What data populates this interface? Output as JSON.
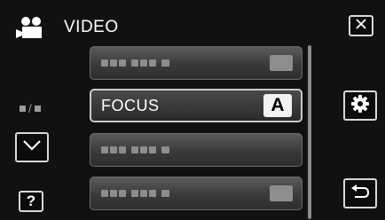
{
  "header": {
    "icon": "movie-camera-icon",
    "title": "VIDEO"
  },
  "menu": {
    "items": [
      {
        "label": "",
        "value": "",
        "state": "dimmed"
      },
      {
        "label": "FOCUS",
        "value": "A",
        "state": "selected"
      },
      {
        "label": "",
        "value": "",
        "state": "dimmed"
      },
      {
        "label": "",
        "value": "",
        "state": "dimmed"
      }
    ]
  },
  "page_indicator": {
    "separator": "/"
  },
  "buttons": {
    "close_icon": "close-icon",
    "settings_icon": "gear-icon",
    "scroll_down_icon": "chevron-down-icon",
    "help_label": "?",
    "back_icon": "return-arrow-icon"
  },
  "colors": {
    "background": "#111111",
    "button_border": "#d9d9d9",
    "item_dimmed_text": "#8d8d8d",
    "badge_background": "#f2f2f2"
  }
}
